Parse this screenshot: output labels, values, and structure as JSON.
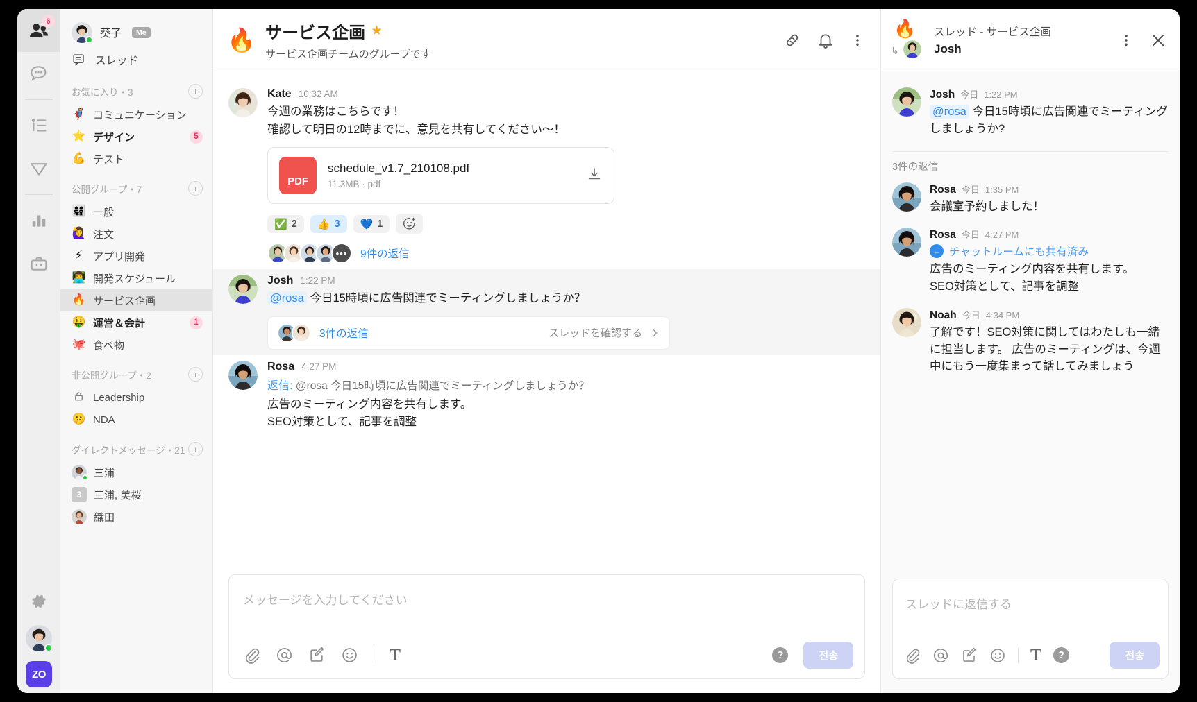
{
  "rail": {
    "items": [
      {
        "name": "contacts-icon",
        "badge": "6",
        "active": true
      },
      {
        "name": "chat-icon",
        "badge": "",
        "active": false
      },
      {
        "name": "org-chart-icon",
        "badge": "",
        "active": false
      },
      {
        "name": "send-icon",
        "badge": "",
        "active": false
      },
      {
        "name": "stats-icon",
        "badge": "",
        "active": false
      },
      {
        "name": "toolbox-icon",
        "badge": "",
        "active": false
      }
    ],
    "logo_text": "ZO"
  },
  "sidebar": {
    "me": {
      "name": "葵子",
      "tag": "Me",
      "status": "online"
    },
    "threads_label": "スレッド",
    "sections": [
      {
        "title": "お気に入り・3",
        "items": [
          {
            "emoji": "🦸‍♀️",
            "name": "コミュニケーション",
            "badge": "",
            "bold": false
          },
          {
            "emoji": "⭐",
            "name": "デザイン",
            "badge": "5",
            "bold": true
          },
          {
            "emoji": "💪",
            "name": "テスト",
            "badge": "",
            "bold": false
          }
        ]
      },
      {
        "title": "公開グループ・7",
        "items": [
          {
            "emoji": "👨‍👩‍👧‍👦",
            "name": "一般",
            "badge": "",
            "bold": false
          },
          {
            "emoji": "🙋‍♀️",
            "name": "注文",
            "badge": "",
            "bold": false
          },
          {
            "emoji": "⚡",
            "name": "アプリ開発",
            "badge": "",
            "bold": false
          },
          {
            "emoji": "👨‍💻",
            "name": "開発スケジュール",
            "badge": "",
            "bold": false
          },
          {
            "emoji": "🔥",
            "name": "サービス企画",
            "badge": "",
            "bold": false,
            "active": true
          },
          {
            "emoji": "🤑",
            "name": "運営＆会計",
            "badge": "1",
            "bold": true
          },
          {
            "emoji": "🐙",
            "name": "食べ物",
            "badge": "",
            "bold": false
          }
        ]
      },
      {
        "title": "非公開グループ・2",
        "items": [
          {
            "emoji": "🔒",
            "name": "Leadership",
            "badge": "",
            "bold": false
          },
          {
            "emoji": "🤫",
            "name": "NDA",
            "badge": "",
            "bold": false
          }
        ]
      }
    ],
    "dm_section": {
      "title": "ダイレクトメッセージ・21",
      "items": [
        {
          "kind": "avatar",
          "name": "三浦",
          "status": "online"
        },
        {
          "kind": "count",
          "count": "3",
          "name": "三浦, 美桜"
        },
        {
          "kind": "avatar",
          "name": "織田",
          "status": ""
        }
      ]
    }
  },
  "chat": {
    "header": {
      "emoji": "🔥",
      "title": "サービス企画",
      "starred": true,
      "subtitle": "サービス企画チームのグループです",
      "icons": [
        "link-icon",
        "bell-icon",
        "more-vertical-icon"
      ]
    },
    "messages": [
      {
        "author": "Kate",
        "time": "10:32 AM",
        "lines": [
          "今週の業務はこちらです！",
          "確認して明日の12時までに、意見を共有してください〜！"
        ],
        "file": {
          "name": "schedule_v1.7_210108.pdf",
          "meta": "11.3MB · pdf",
          "type": "PDF"
        },
        "reactions": [
          {
            "emoji": "✅",
            "count": "2",
            "mine": false
          },
          {
            "emoji": "👍",
            "count": "3",
            "mine": true
          },
          {
            "emoji": "💙",
            "count": "1",
            "mine": false
          }
        ],
        "replies_link": "9件の返信",
        "reply_avatars": 4,
        "reply_more": "•••"
      },
      {
        "author": "Josh",
        "time": "1:22 PM",
        "mention": "@rosa",
        "text": "今日15時頃に広告関連でミーティングしましょうか？",
        "highlight": true,
        "thread_chip": {
          "link": "3件の返信",
          "cta": "スレッドを確認する"
        }
      },
      {
        "author": "Rosa",
        "time": "4:27 PM",
        "reply_prefix": "返信:",
        "reply_quote": "@rosa 今日15時頃に広告関連でミーティングしましょうか？",
        "lines": [
          "広告のミーティング内容を共有します。",
          "SEO対策として、記事を調整"
        ]
      }
    ],
    "composer": {
      "placeholder": "メッセージを入力してください",
      "tools": [
        "attach-icon",
        "mention-icon",
        "memo-icon",
        "emoji-icon",
        "text-format-icon"
      ],
      "help": "?",
      "send_label": "전송"
    }
  },
  "panel": {
    "header": {
      "emoji": "🔥",
      "title": "スレッド - サービス企画",
      "author": "Josh",
      "icons": [
        "more-vertical-icon",
        "close-icon"
      ]
    },
    "root": {
      "author": "Josh",
      "day": "今日",
      "time": "1:22 PM",
      "mention": "@rosa",
      "text": "今日15時頃に広告関連でミーティングしましょうか?"
    },
    "replies_count": "3件の返信",
    "replies": [
      {
        "author": "Rosa",
        "day": "今日",
        "time": "1:35 PM",
        "lines": [
          "会議室予約しました！"
        ]
      },
      {
        "author": "Rosa",
        "day": "今日",
        "time": "4:27 PM",
        "shared": "チャットルームにも共有済み",
        "lines": [
          "広告のミーティング内容を共有します。",
          "SEO対策として、記事を調整"
        ]
      },
      {
        "author": "Noah",
        "day": "今日",
        "time": "4:34 PM",
        "lines": [
          "了解です！SEO対策に関してはわたしも一緒に担当します。 広告のミーティングは、今週中にもう一度集まって話してみましょう"
        ]
      }
    ],
    "composer": {
      "placeholder": "スレッドに返信する",
      "help": "?",
      "send_label": "전송"
    }
  },
  "colors": {
    "accent_blue": "#2f8ced",
    "badge_pink_bg": "#ffd9e1",
    "badge_pink_fg": "#f0305c",
    "send_bg": "#cdd3f5",
    "pdf_red": "#f0534e",
    "star_orange": "#f7a81b",
    "online_green": "#25c940"
  }
}
